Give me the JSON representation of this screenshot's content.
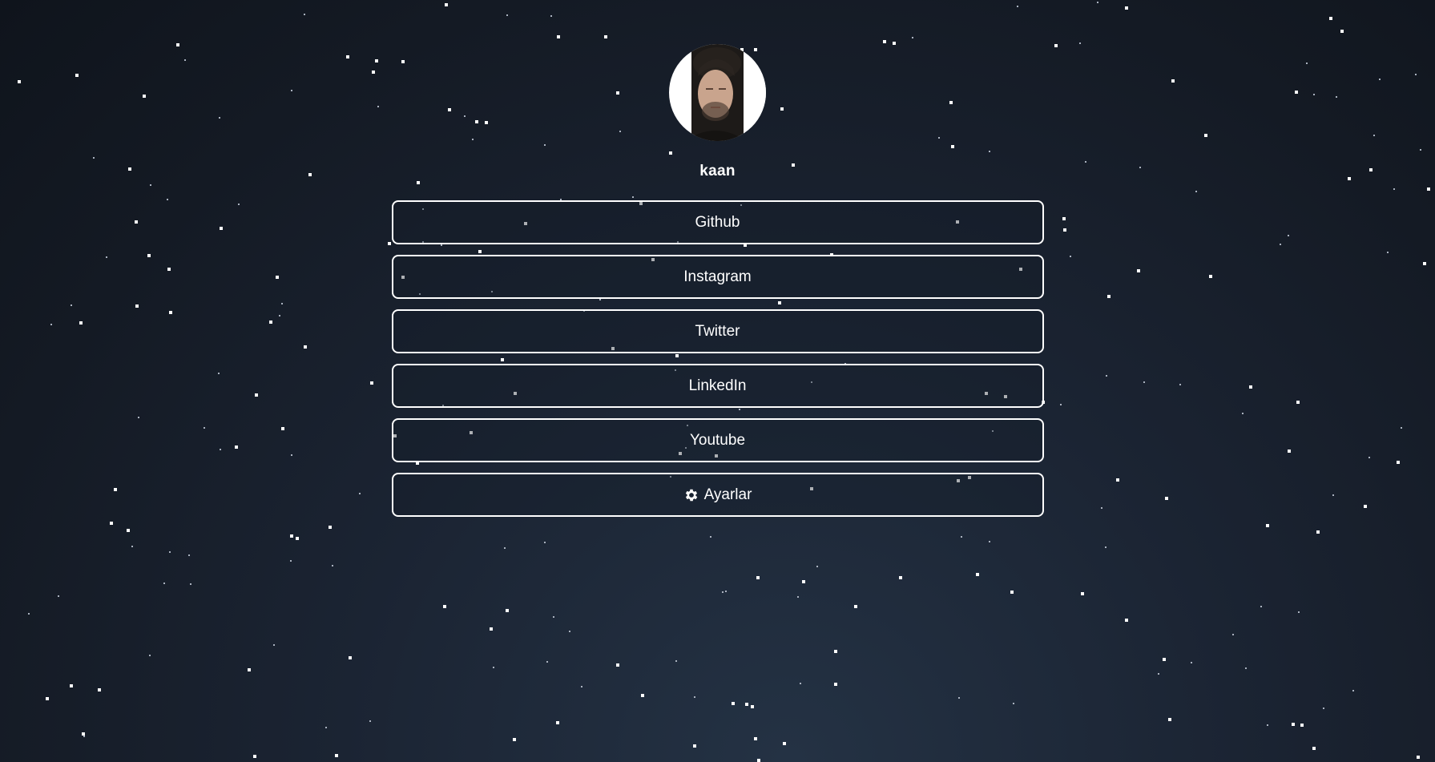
{
  "profile": {
    "username": "kaan",
    "avatar_icon": "profile-photo"
  },
  "links": [
    {
      "label": "Github"
    },
    {
      "label": "Instagram"
    },
    {
      "label": "Twitter"
    },
    {
      "label": "LinkedIn"
    },
    {
      "label": "Youtube"
    }
  ],
  "settings": {
    "label": "Ayarlar",
    "icon": "gear-icon"
  },
  "colors": {
    "background_top": "#0f141c",
    "background_bottom": "#243244",
    "button_border": "#ffffff",
    "text": "#ffffff"
  }
}
